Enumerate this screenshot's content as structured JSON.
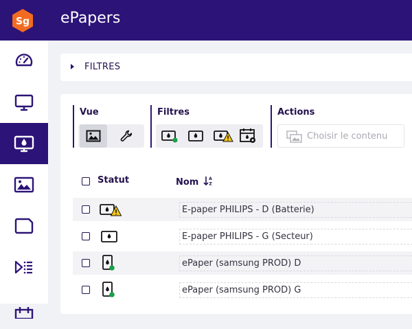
{
  "app": {
    "title": "ePapers",
    "logo_text": "Sg",
    "logo_color": "#f26b21",
    "brand_color": "#2c1377"
  },
  "sidebar": {
    "items": [
      {
        "icon": "dashboard-gauge-icon",
        "active": false
      },
      {
        "icon": "monitor-icon",
        "active": false
      },
      {
        "icon": "epaper-display-icon",
        "active": true
      },
      {
        "icon": "image-icon",
        "active": false
      },
      {
        "icon": "folder-icon",
        "active": false
      },
      {
        "icon": "playlist-icon",
        "active": false
      },
      {
        "icon": "calendar-icon",
        "active": false
      }
    ]
  },
  "filters_bar": {
    "label": "FILTRES"
  },
  "toolbar": {
    "view": {
      "title": "Vue",
      "buttons": [
        "image-view-icon",
        "wrench-icon"
      ],
      "selected": 0
    },
    "filters": {
      "title": "Filtres",
      "buttons": [
        "epaper-online-icon",
        "epaper-icon",
        "epaper-warning-icon",
        "calendar-settings-icon"
      ]
    },
    "actions": {
      "title": "Actions",
      "choose_label": "Choisir le contenu"
    }
  },
  "table": {
    "columns": {
      "status": "Statut",
      "name": "Nom"
    },
    "rows": [
      {
        "status_icon": "epaper-landscape-warning-icon",
        "name": "E-paper PHILIPS - D (Batterie)"
      },
      {
        "status_icon": "epaper-landscape-icon",
        "name": "E-paper PHILIPS - G (Secteur)"
      },
      {
        "status_icon": "epaper-portrait-online-icon",
        "name": "ePaper (samsung PROD) D"
      },
      {
        "status_icon": "epaper-portrait-online-icon",
        "name": "ePaper (samsung PROD) G"
      }
    ]
  },
  "colors": {
    "online_green": "#1aa04a",
    "warning_yellow": "#f5c518"
  }
}
